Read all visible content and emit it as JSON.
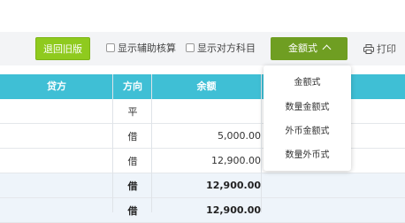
{
  "toolbar": {
    "return_old_label": "退回旧版",
    "show_aux_label": "显示辅助核算",
    "show_opposite_label": "显示对方科目",
    "mode_label": "金额式",
    "print_label": "打印"
  },
  "table": {
    "headers": {
      "credit": "贷方",
      "direction": "方向",
      "balance": "余额"
    },
    "rows": [
      {
        "direction": "平",
        "balance": ""
      },
      {
        "direction": "借",
        "balance": "5,000.00"
      },
      {
        "direction": "借",
        "balance": "12,900.00"
      },
      {
        "direction": "借",
        "balance": "12,900.00",
        "summary": true
      },
      {
        "direction": "借",
        "balance": "12,900.00",
        "summary": true
      }
    ]
  },
  "dropdown": {
    "items": [
      "金额式",
      "数量金额式",
      "外币金额式",
      "数量外币式"
    ]
  },
  "colors": {
    "header_bg": "#3fbfd5",
    "return_button": "#8fca1e",
    "mode_button": "#6f9e22"
  }
}
